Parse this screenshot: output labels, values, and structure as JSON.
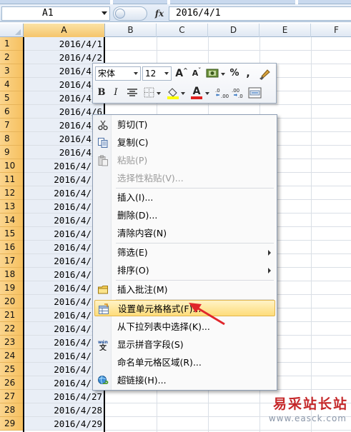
{
  "formula_bar": {
    "name_box": "A1",
    "fx": "fx",
    "formula": "2016/4/1"
  },
  "columns": [
    "A",
    "B",
    "C",
    "D",
    "E",
    "F"
  ],
  "rows": [
    {
      "n": "1",
      "a": "2016/4/1"
    },
    {
      "n": "2",
      "a": "2016/4/2"
    },
    {
      "n": "3",
      "a": "2016/4/3"
    },
    {
      "n": "4",
      "a": "2016/4/4"
    },
    {
      "n": "5",
      "a": "2016/4/5"
    },
    {
      "n": "6",
      "a": "2016/4/6"
    },
    {
      "n": "7",
      "a": "2016/4/7"
    },
    {
      "n": "8",
      "a": "2016/4/8"
    },
    {
      "n": "9",
      "a": "2016/4/9"
    },
    {
      "n": "10",
      "a": "2016/4/10"
    },
    {
      "n": "11",
      "a": "2016/4/11"
    },
    {
      "n": "12",
      "a": "2016/4/12"
    },
    {
      "n": "13",
      "a": "2016/4/13"
    },
    {
      "n": "14",
      "a": "2016/4/14"
    },
    {
      "n": "15",
      "a": "2016/4/15"
    },
    {
      "n": "16",
      "a": "2016/4/16"
    },
    {
      "n": "17",
      "a": "2016/4/17"
    },
    {
      "n": "18",
      "a": "2016/4/18"
    },
    {
      "n": "19",
      "a": "2016/4/19"
    },
    {
      "n": "20",
      "a": "2016/4/20"
    },
    {
      "n": "21",
      "a": "2016/4/21"
    },
    {
      "n": "22",
      "a": "2016/4/22"
    },
    {
      "n": "23",
      "a": "2016/4/23"
    },
    {
      "n": "24",
      "a": "2016/4/24"
    },
    {
      "n": "25",
      "a": "2016/4/25"
    },
    {
      "n": "26",
      "a": "2016/4/26"
    },
    {
      "n": "27",
      "a": "2016/4/27"
    },
    {
      "n": "28",
      "a": "2016/4/28"
    },
    {
      "n": "29",
      "a": "2016/4/29"
    }
  ],
  "mini_toolbar": {
    "font_name": "宋体",
    "font_size": "12",
    "grow_font": "A",
    "shrink_font": "A",
    "percent": "%",
    "comma": ",",
    "bold": "B",
    "italic": "I",
    "font_color_letter": "A",
    "fill_color": "#ffff00",
    "font_color": "#e02020"
  },
  "context_menu": {
    "items": [
      {
        "label": "剪切(T)",
        "icon": "scissors-icon",
        "disabled": false
      },
      {
        "label": "复制(C)",
        "icon": "copy-icon",
        "disabled": false
      },
      {
        "label": "粘贴(P)",
        "icon": "paste-icon",
        "disabled": true
      },
      {
        "label": "选择性粘贴(V)...",
        "icon": "",
        "disabled": true
      },
      {
        "label": "插入(I)...",
        "icon": "",
        "disabled": false
      },
      {
        "label": "删除(D)...",
        "icon": "",
        "disabled": false
      },
      {
        "label": "清除内容(N)",
        "icon": "",
        "disabled": false
      },
      {
        "label": "筛选(E)",
        "icon": "",
        "disabled": false,
        "submenu": true
      },
      {
        "label": "排序(O)",
        "icon": "",
        "disabled": false,
        "submenu": true
      },
      {
        "label": "插入批注(M)",
        "icon": "comment-icon",
        "disabled": false
      },
      {
        "label": "设置单元格格式(F)...",
        "icon": "format-cells-icon",
        "disabled": false,
        "highlighted": true
      },
      {
        "label": "从下拉列表中选择(K)...",
        "icon": "",
        "disabled": false
      },
      {
        "label": "显示拼音字段(S)",
        "icon": "phonetic-icon",
        "disabled": false
      },
      {
        "label": "命名单元格区域(R)...",
        "icon": "",
        "disabled": false
      },
      {
        "label": "超链接(H)...",
        "icon": "hyperlink-icon",
        "disabled": false
      }
    ]
  },
  "watermark": {
    "title": "易采站长站",
    "url": "www.easck.com"
  },
  "colors": {
    "highlight": "#fedc7a",
    "annotation_arrow": "#e0262b",
    "row_header_selected": "#f6c05f"
  }
}
